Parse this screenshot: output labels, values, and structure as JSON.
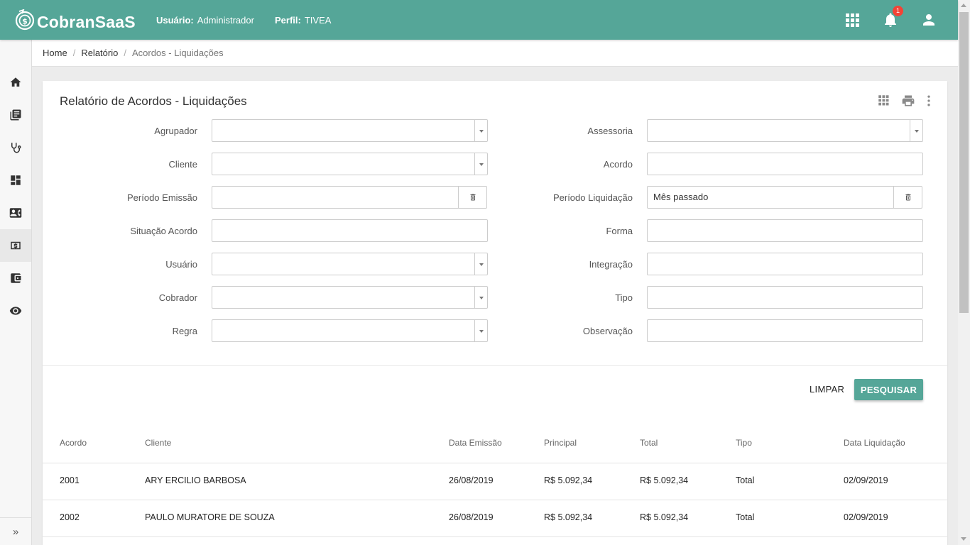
{
  "app": {
    "name": "CobranSaaS"
  },
  "topbar": {
    "user_label": "Usuário:",
    "user_value": "Administrador",
    "profile_label": "Perfil:",
    "profile_value": "TIVEA",
    "notification_count": "1"
  },
  "icons": {
    "apps": "apps-grid-icon",
    "notifications": "bell-icon",
    "account": "person-icon",
    "sidebar": [
      "home-icon",
      "book-icon",
      "stethoscope-icon",
      "dashboard-icon",
      "contact-card-icon",
      "money-icon",
      "wallet-icon",
      "eye-icon"
    ]
  },
  "colors": {
    "primary": "#55a698",
    "badge": "#f44336"
  },
  "breadcrumb": {
    "home": "Home",
    "relatorio": "Relatório",
    "current": "Acordos - Liquidações"
  },
  "card": {
    "title": "Relatório de Acordos - Liquidações"
  },
  "form": {
    "left": {
      "agrupador": {
        "label": "Agrupador",
        "value": ""
      },
      "cliente": {
        "label": "Cliente",
        "value": ""
      },
      "periodo_emissao": {
        "label": "Período Emissão",
        "value": ""
      },
      "situacao_acordo": {
        "label": "Situação Acordo",
        "value": ""
      },
      "usuario": {
        "label": "Usuário",
        "value": ""
      },
      "cobrador": {
        "label": "Cobrador",
        "value": ""
      },
      "regra": {
        "label": "Regra",
        "value": ""
      }
    },
    "right": {
      "assessoria": {
        "label": "Assessoria",
        "value": ""
      },
      "acordo": {
        "label": "Acordo",
        "value": ""
      },
      "periodo_liquidacao": {
        "label": "Período Liquidação",
        "value": "Mês passado"
      },
      "forma": {
        "label": "Forma",
        "value": ""
      },
      "integracao": {
        "label": "Integração",
        "value": ""
      },
      "tipo": {
        "label": "Tipo",
        "value": ""
      },
      "observacao": {
        "label": "Observação",
        "value": ""
      }
    }
  },
  "actions": {
    "clear": "LIMPAR",
    "search": "PESQUISAR"
  },
  "table": {
    "columns": [
      "Acordo",
      "Cliente",
      "Data Emissão",
      "Principal",
      "Total",
      "Tipo",
      "Data Liquidação"
    ],
    "rows": [
      [
        "2001",
        "ARY ERCILIO BARBOSA",
        "26/08/2019",
        "R$ 5.092,34",
        "R$ 5.092,34",
        "Total",
        "02/09/2019"
      ],
      [
        "2002",
        "PAULO MURATORE DE SOUZA",
        "26/08/2019",
        "R$ 5.092,34",
        "R$ 5.092,34",
        "Total",
        "02/09/2019"
      ]
    ]
  }
}
